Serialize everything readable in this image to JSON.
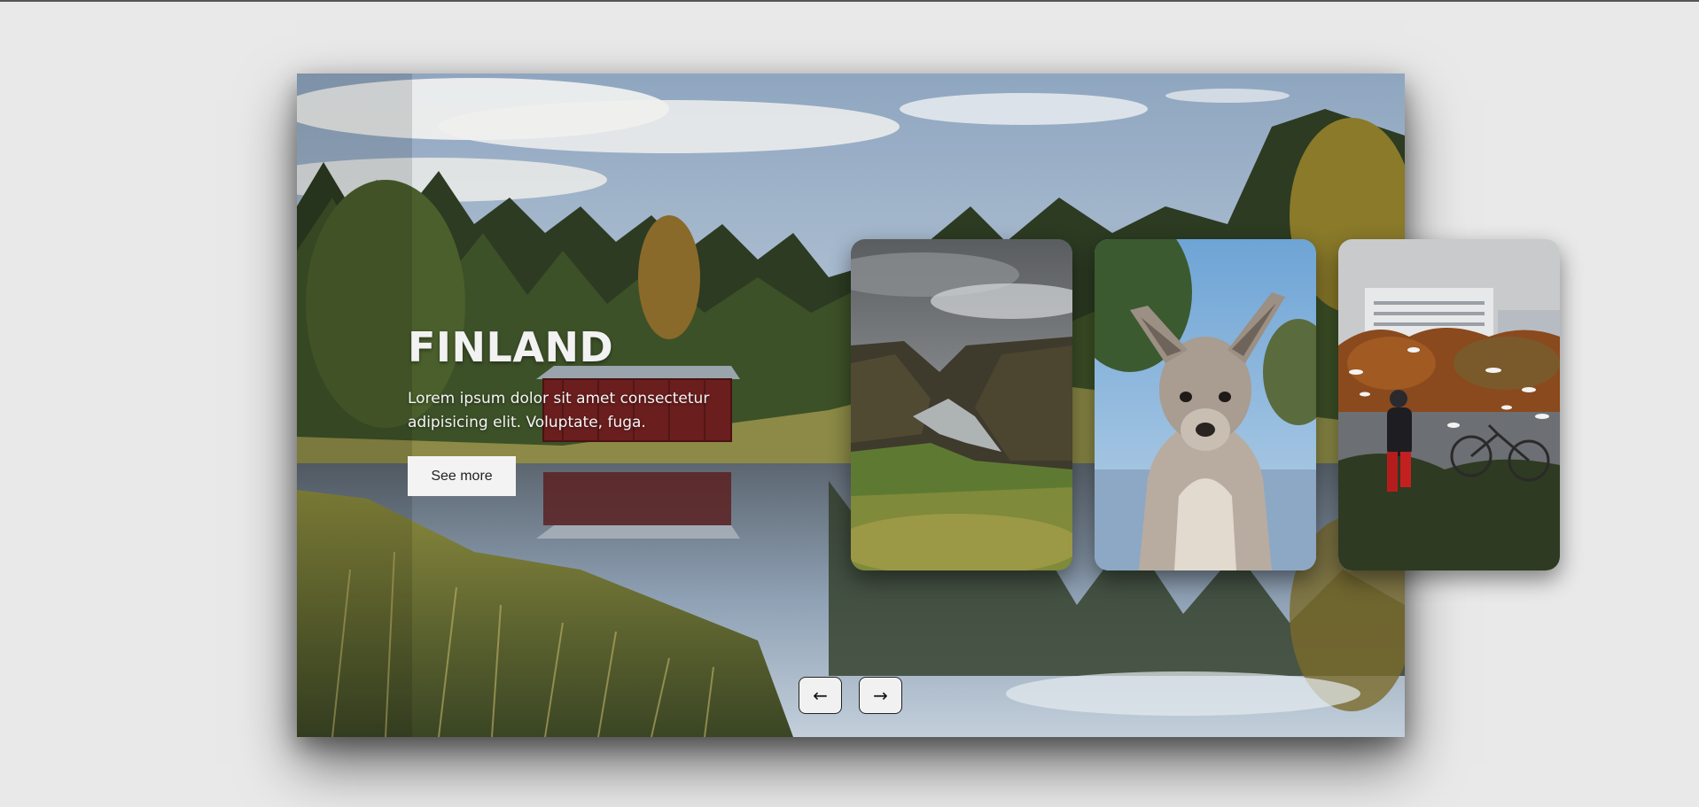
{
  "slide": {
    "title": "FINLAND",
    "description": "Lorem ipsum dolor sit amet consectetur adipisicing elit. Voluptate, fuga.",
    "button_label": "See more"
  },
  "cards": [
    {
      "icon": "river-canyon-image"
    },
    {
      "icon": "kangaroo-image"
    },
    {
      "icon": "city-lake-birds-image"
    }
  ],
  "nav": {
    "prev_icon": "arrow-left-icon",
    "prev_glyph": "←",
    "next_icon": "arrow-right-icon",
    "next_glyph": "→"
  },
  "colors": {
    "page_background": "#e9e9e9",
    "button_background": "#f3f3f3",
    "title_text": "#f2f2f2"
  }
}
